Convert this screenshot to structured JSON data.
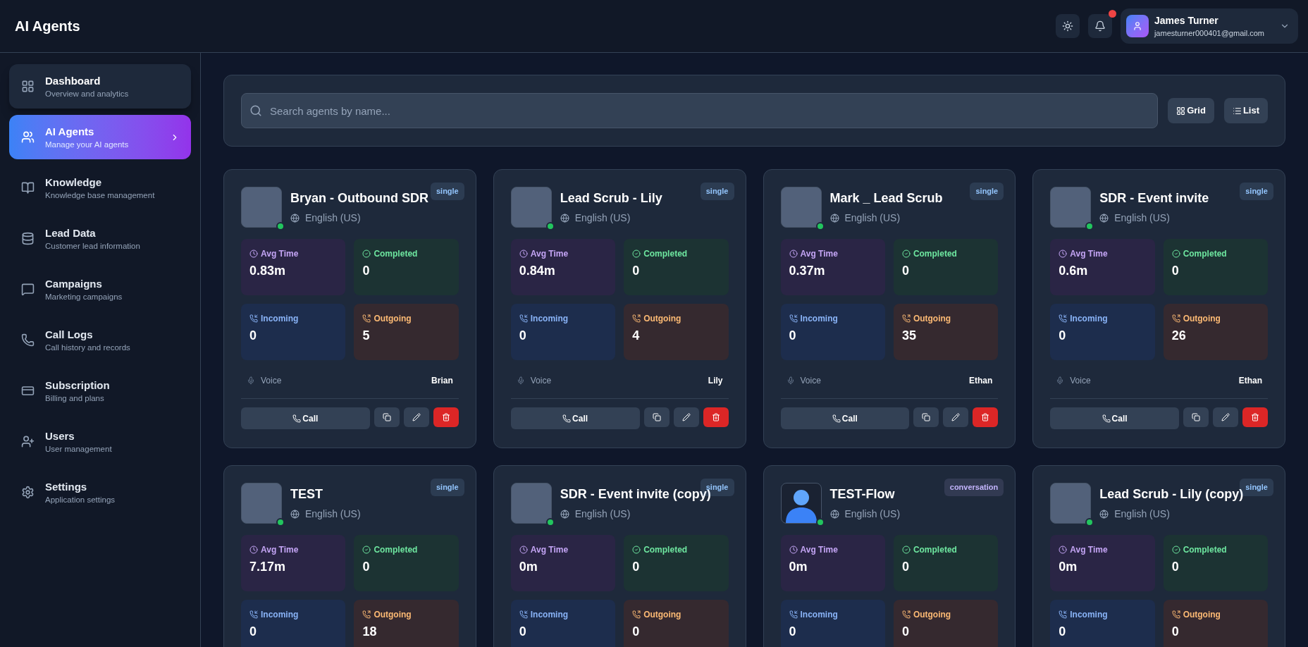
{
  "header": {
    "title": "AI Agents",
    "user": {
      "name": "James Turner",
      "email": "jamesturner000401@gmail.com"
    },
    "notifications_unread": true
  },
  "sidebar": {
    "items": [
      {
        "label": "Dashboard",
        "subtitle": "Overview and analytics",
        "selected": false,
        "hovered": true
      },
      {
        "label": "AI Agents",
        "subtitle": "Manage your AI agents",
        "selected": true,
        "hovered": false
      },
      {
        "label": "Knowledge",
        "subtitle": "Knowledge base management",
        "selected": false,
        "hovered": false
      },
      {
        "label": "Lead Data",
        "subtitle": "Customer lead information",
        "selected": false,
        "hovered": false
      },
      {
        "label": "Campaigns",
        "subtitle": "Marketing campaigns",
        "selected": false,
        "hovered": false
      },
      {
        "label": "Call Logs",
        "subtitle": "Call history and records",
        "selected": false,
        "hovered": false
      },
      {
        "label": "Subscription",
        "subtitle": "Billing and plans",
        "selected": false,
        "hovered": false
      },
      {
        "label": "Users",
        "subtitle": "User management",
        "selected": false,
        "hovered": false
      },
      {
        "label": "Settings",
        "subtitle": "Application settings",
        "selected": false,
        "hovered": false
      }
    ]
  },
  "search": {
    "placeholder": "Search agents by name..."
  },
  "view_toggle": [
    {
      "label": "Grid",
      "kind": "grid"
    },
    {
      "label": "List",
      "kind": "list"
    }
  ],
  "agents": [
    {
      "name": "Bryan - Outbound SDR",
      "kind": "photo",
      "online": true,
      "badge": {
        "label": "single",
        "color": "#93c5fd"
      },
      "language": "English (US)",
      "stats": [
        {
          "label": "Avg Time",
          "value": "0.83m"
        },
        {
          "label": "Completed",
          "value": "0"
        },
        {
          "label": "Incoming",
          "value": "0"
        },
        {
          "label": "Outgoing",
          "value": "5"
        }
      ],
      "voice_label": "Voice",
      "voice": "Brian",
      "call_label": "Call"
    },
    {
      "name": "Lead Scrub - Lily",
      "kind": "photo",
      "online": true,
      "badge": {
        "label": "single",
        "color": "#93c5fd"
      },
      "language": "English (US)",
      "stats": [
        {
          "label": "Avg Time",
          "value": "0.84m"
        },
        {
          "label": "Completed",
          "value": "0"
        },
        {
          "label": "Incoming",
          "value": "0"
        },
        {
          "label": "Outgoing",
          "value": "4"
        }
      ],
      "voice_label": "Voice",
      "voice": "Lily",
      "call_label": "Call"
    },
    {
      "name": "Mark _ Lead Scrub",
      "kind": "photo",
      "online": true,
      "badge": {
        "label": "single",
        "color": "#93c5fd"
      },
      "language": "English (US)",
      "stats": [
        {
          "label": "Avg Time",
          "value": "0.37m"
        },
        {
          "label": "Completed",
          "value": "0"
        },
        {
          "label": "Incoming",
          "value": "0"
        },
        {
          "label": "Outgoing",
          "value": "35"
        }
      ],
      "voice_label": "Voice",
      "voice": "Ethan",
      "call_label": "Call"
    },
    {
      "name": "SDR - Event invite",
      "kind": "photo",
      "online": true,
      "badge": {
        "label": "single",
        "color": "#93c5fd"
      },
      "language": "English (US)",
      "stats": [
        {
          "label": "Avg Time",
          "value": "0.6m"
        },
        {
          "label": "Completed",
          "value": "0"
        },
        {
          "label": "Incoming",
          "value": "0"
        },
        {
          "label": "Outgoing",
          "value": "26"
        }
      ],
      "voice_label": "Voice",
      "voice": "Ethan",
      "call_label": "Call"
    },
    {
      "name": "TEST",
      "kind": "photo",
      "online": true,
      "badge": {
        "label": "single",
        "color": "#93c5fd"
      },
      "language": "English (US)",
      "stats": [
        {
          "label": "Avg Time",
          "value": "7.17m"
        },
        {
          "label": "Completed",
          "value": "0"
        },
        {
          "label": "Incoming",
          "value": "0"
        },
        {
          "label": "Outgoing",
          "value": "18"
        }
      ]
    },
    {
      "name": "SDR - Event invite (copy)",
      "kind": "photo",
      "online": true,
      "badge": {
        "label": "single",
        "color": "#93c5fd"
      },
      "language": "English (US)",
      "stats": [
        {
          "label": "Avg Time",
          "value": "0m"
        },
        {
          "label": "Completed",
          "value": "0"
        },
        {
          "label": "Incoming",
          "value": "0"
        },
        {
          "label": "Outgoing",
          "value": "0"
        }
      ]
    },
    {
      "name": "TEST-Flow",
      "kind": "default",
      "online": true,
      "badge": {
        "label": "conversation",
        "color": "#c4b5fd"
      },
      "language": "English (US)",
      "stats": [
        {
          "label": "Avg Time",
          "value": "0m"
        },
        {
          "label": "Completed",
          "value": "0"
        },
        {
          "label": "Incoming",
          "value": "0"
        },
        {
          "label": "Outgoing",
          "value": "0"
        }
      ]
    },
    {
      "name": "Lead Scrub - Lily (copy)",
      "kind": "photo",
      "online": true,
      "badge": {
        "label": "single",
        "color": "#93c5fd"
      },
      "language": "English (US)",
      "stats": [
        {
          "label": "Avg Time",
          "value": "0m"
        },
        {
          "label": "Completed",
          "value": "0"
        },
        {
          "label": "Incoming",
          "value": "0"
        },
        {
          "label": "Outgoing",
          "value": "0"
        }
      ]
    }
  ]
}
